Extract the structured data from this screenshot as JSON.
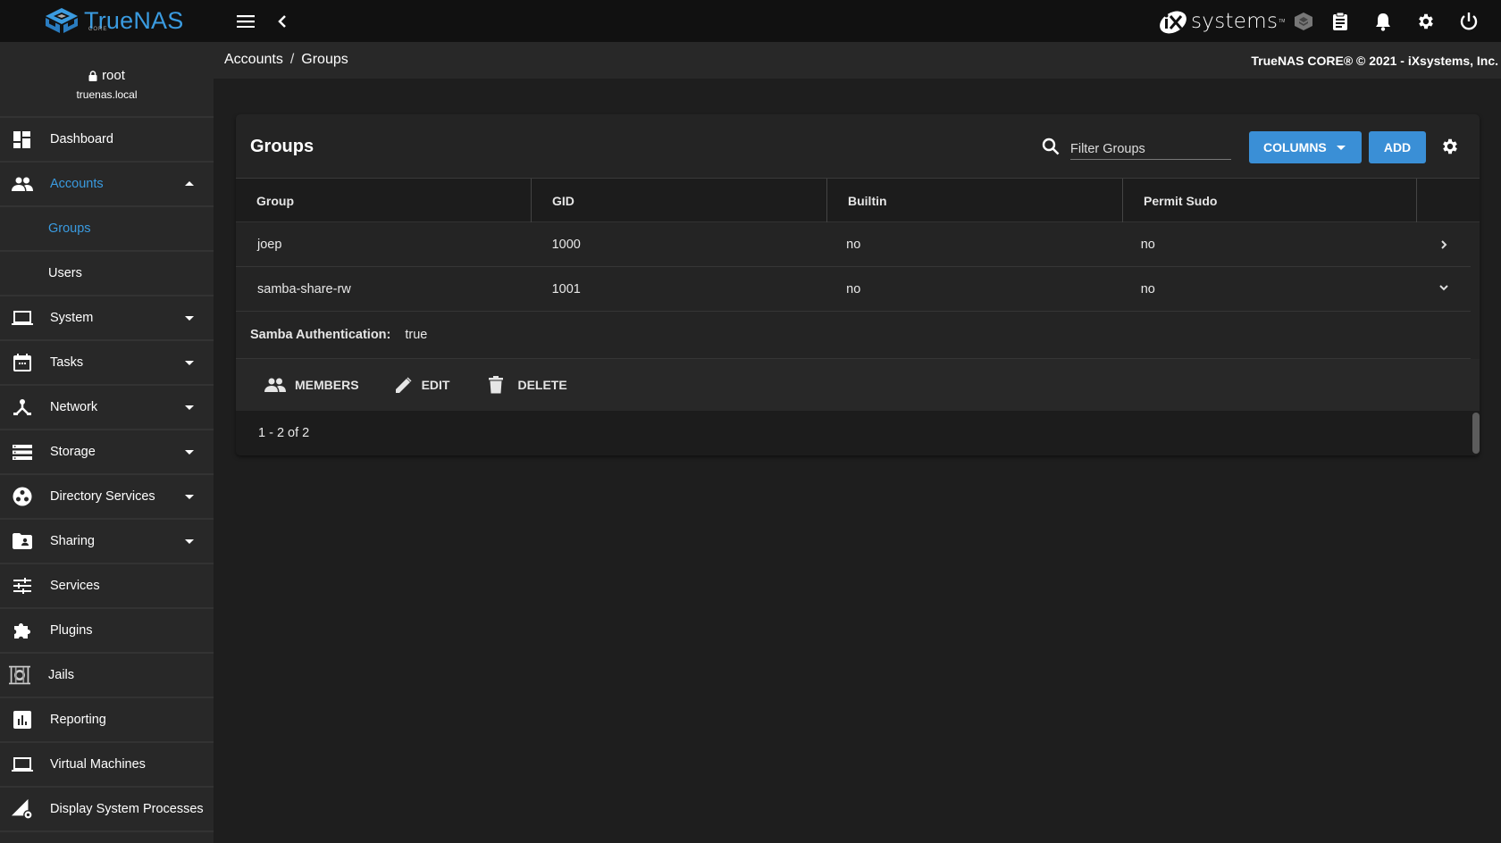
{
  "topbar": {
    "brand": "TrueNAS",
    "brand_sub": "CORE",
    "vendor": "systems",
    "vendor_tm": "TM",
    "icons": [
      "menu-icon",
      "chevron-left-icon",
      "truecommand-icon",
      "clipboard-icon",
      "bell-icon",
      "gear-icon",
      "power-icon"
    ]
  },
  "breadcrumb": {
    "items": [
      "Accounts",
      "Groups"
    ],
    "separator": "/"
  },
  "copyright": "TrueNAS CORE® © 2021 - iXsystems, Inc.",
  "user": {
    "name": "root",
    "host": "truenas.local"
  },
  "sidebar": {
    "items": [
      {
        "label": "Dashboard",
        "icon": "dashboard-icon"
      },
      {
        "label": "Accounts",
        "icon": "people-icon",
        "expanded": true,
        "active": true
      },
      {
        "label": "Groups",
        "sub": true,
        "active": true
      },
      {
        "label": "Users",
        "sub": true
      },
      {
        "label": "System",
        "icon": "laptop-icon",
        "expandable": true
      },
      {
        "label": "Tasks",
        "icon": "calendar-icon",
        "expandable": true
      },
      {
        "label": "Network",
        "icon": "network-icon",
        "expandable": true
      },
      {
        "label": "Storage",
        "icon": "storage-icon",
        "expandable": true
      },
      {
        "label": "Directory Services",
        "icon": "directory-icon",
        "expandable": true
      },
      {
        "label": "Sharing",
        "icon": "folder-shared-icon",
        "expandable": true
      },
      {
        "label": "Services",
        "icon": "tune-icon"
      },
      {
        "label": "Plugins",
        "icon": "puzzle-icon"
      },
      {
        "label": "Jails",
        "icon": "jail-icon"
      },
      {
        "label": "Reporting",
        "icon": "chart-icon"
      },
      {
        "label": "Virtual Machines",
        "icon": "laptop-icon"
      },
      {
        "label": "Display System Processes",
        "icon": "processes-icon"
      }
    ]
  },
  "card": {
    "title": "Groups",
    "filter_placeholder": "Filter Groups",
    "filter_value": "",
    "columns_label": "COLUMNS",
    "add_label": "ADD",
    "table": {
      "headers": [
        "Group",
        "GID",
        "Builtin",
        "Permit Sudo"
      ],
      "rows": [
        {
          "group": "joep",
          "gid": "1000",
          "builtin": "no",
          "sudo": "no",
          "expanded": false
        },
        {
          "group": "samba-share-rw",
          "gid": "1001",
          "builtin": "no",
          "sudo": "no",
          "expanded": true
        }
      ]
    },
    "detail": {
      "label": "Samba Authentication:",
      "value": "true"
    },
    "actions": [
      "MEMBERS",
      "EDIT",
      "DELETE"
    ],
    "pager": "1 - 2 of 2"
  },
  "colors": {
    "accent": "#3a8fd6",
    "brand": "#3a9be0",
    "topbar_bg": "#111111",
    "sidebar_bg": "#282828",
    "page_bg": "#1e1e1e"
  }
}
